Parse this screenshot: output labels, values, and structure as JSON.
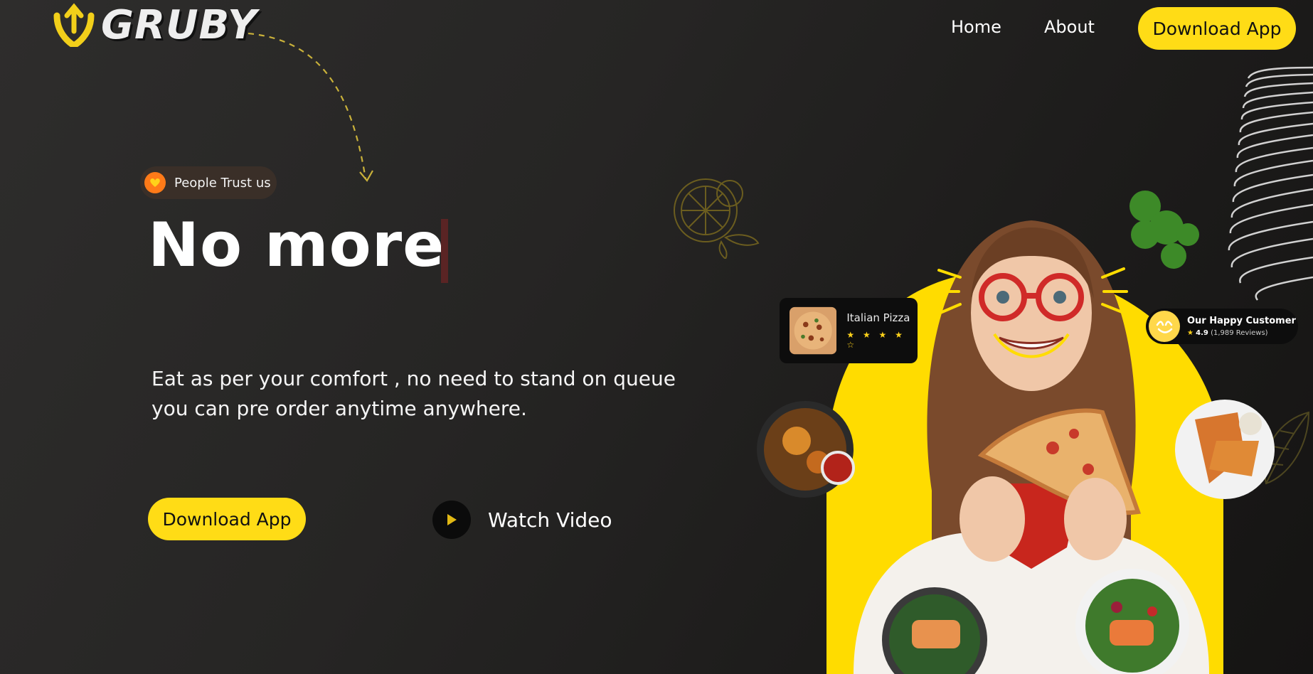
{
  "header": {
    "logo_text": "GRUBY",
    "nav": {
      "home": "Home",
      "about": "About",
      "download": "Download App"
    }
  },
  "hero": {
    "badge": "People Trust us",
    "headline": "No more",
    "subtext_line1": "Eat as per your comfort , no need to stand on queue",
    "subtext_line2": "you can pre order anytime anywhere.",
    "download_label": "Download App",
    "watch_label": "Watch Video"
  },
  "cards": {
    "pizza": {
      "title": "Italian Pizza",
      "stars": "★ ★ ★ ★ ☆"
    },
    "customer": {
      "title": "Our Happy Customer",
      "rating": "4.9",
      "reviews": "(1,989 Reviews)"
    }
  },
  "colors": {
    "accent": "#ffdc16",
    "background": "#262524",
    "badge_orange": "#ff7a18"
  },
  "icons": [
    "logo-mark-icon",
    "heart-icon",
    "play-icon",
    "star-icon",
    "smile-icon"
  ]
}
